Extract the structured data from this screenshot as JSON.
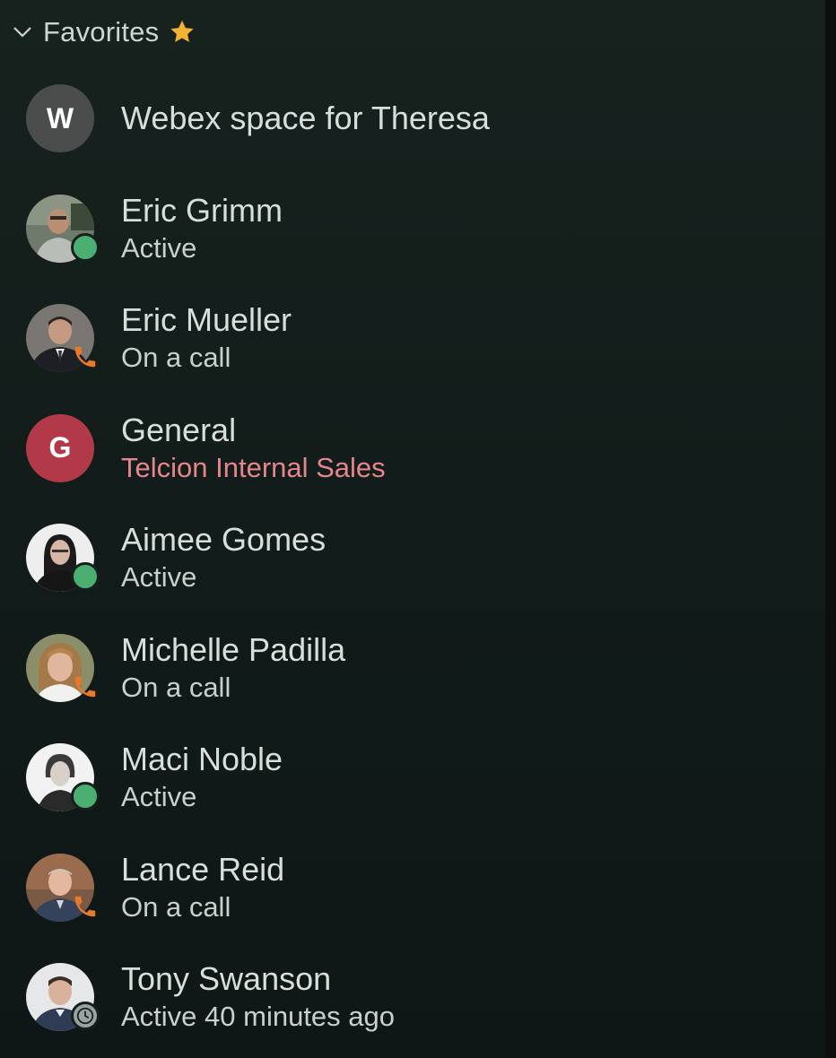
{
  "section": {
    "title": "Favorites",
    "chevron_icon": "chevron-down-icon",
    "star_icon": "star-icon",
    "star_color": "#f3b233"
  },
  "items": [
    {
      "name": "Webex space for Theresa",
      "status": "",
      "avatar_letter": "W",
      "avatar_color": "#4a4d4c",
      "presence": "none"
    },
    {
      "name": "Eric Grimm",
      "status": "Active",
      "avatar_letter": "",
      "avatar_photo": "person-photo",
      "presence": "active"
    },
    {
      "name": "Eric Mueller",
      "status": "On a call",
      "avatar_letter": "",
      "avatar_photo": "person-photo",
      "presence": "call"
    },
    {
      "name": "General",
      "status": "Telcion Internal Sales",
      "avatar_letter": "G",
      "avatar_color": "#b23a48",
      "presence": "none"
    },
    {
      "name": "Aimee Gomes",
      "status": "Active",
      "avatar_letter": "",
      "avatar_photo": "person-photo",
      "presence": "active"
    },
    {
      "name": "Michelle Padilla",
      "status": "On a call",
      "avatar_letter": "",
      "avatar_photo": "person-photo",
      "presence": "call"
    },
    {
      "name": "Maci Noble",
      "status": "Active",
      "avatar_letter": "",
      "avatar_photo": "person-photo",
      "presence": "active"
    },
    {
      "name": "Lance Reid",
      "status": "On a call",
      "avatar_letter": "",
      "avatar_photo": "person-photo",
      "presence": "call"
    },
    {
      "name": "Tony Swanson",
      "status": "Active 40 minutes ago",
      "avatar_letter": "",
      "avatar_photo": "person-photo",
      "presence": "away"
    }
  ],
  "colors": {
    "active": "#4caf72",
    "call": "#e8792b",
    "team_subtitle": "#e5868d"
  }
}
